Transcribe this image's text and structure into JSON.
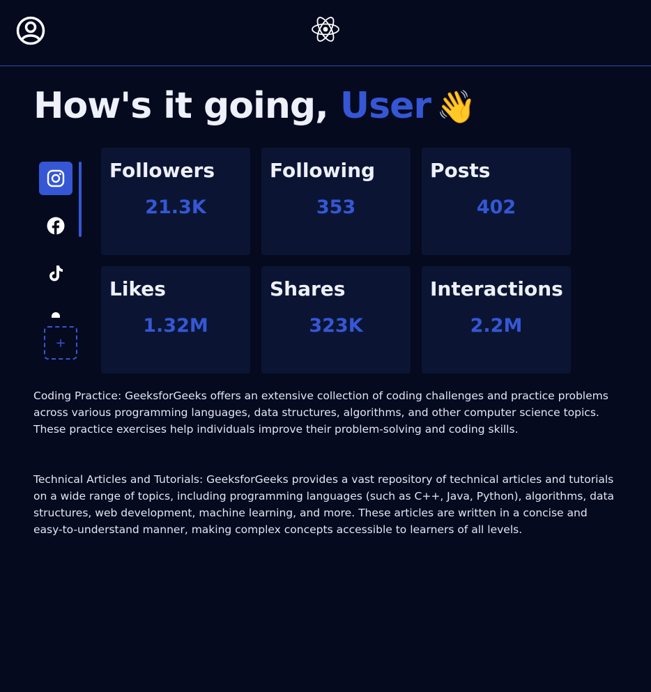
{
  "header": {
    "user_icon": "user-circle-icon",
    "logo_icon": "react-atom-icon"
  },
  "greeting": {
    "prefix": "How's it going, ",
    "name": "User",
    "emoji": "👋"
  },
  "sidebar": {
    "items": [
      {
        "name": "instagram",
        "icon": "instagram-icon",
        "active": true
      },
      {
        "name": "facebook",
        "icon": "facebook-icon",
        "active": false
      },
      {
        "name": "tiktok",
        "icon": "tiktok-icon",
        "active": false
      }
    ],
    "add_label": "+"
  },
  "stats": [
    {
      "label": "Followers",
      "value": "21.3K"
    },
    {
      "label": "Following",
      "value": "353"
    },
    {
      "label": "Posts",
      "value": "402"
    },
    {
      "label": "Likes",
      "value": "1.32M"
    },
    {
      "label": "Shares",
      "value": "323K"
    },
    {
      "label": "Interactions",
      "value": "2.2M"
    }
  ],
  "content": {
    "paragraph_1": "Coding Practice: GeeksforGeeks offers an extensive collection of coding challenges and practice problems across various programming languages, data structures, algorithms, and other computer science topics. These practice exercises help individuals improve their problem-solving and coding skills.",
    "paragraph_2": "Technical Articles and Tutorials: GeeksforGeeks provides a vast repository of technical articles and tutorials on a wide range of topics, including programming languages (such as C++, Java, Python), algorithms, data structures, web development, machine learning, and more. These articles are written in a concise and easy-to-understand manner, making complex concepts accessible to learners of all levels."
  },
  "colors": {
    "background": "#050a1e",
    "card": "#0b1533",
    "accent": "#3557d6",
    "text": "#eef0fa"
  }
}
